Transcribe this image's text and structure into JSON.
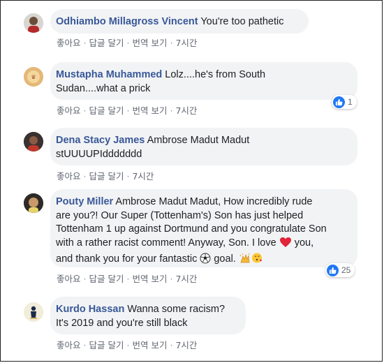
{
  "comments": [
    {
      "author": "Odhiambo Millagross Vincent",
      "text": " You're too pathetic",
      "actions": {
        "like": "좋아요",
        "reply": "답글 달기",
        "translate": "번역 보기",
        "time": "7시간"
      }
    },
    {
      "author": "Mustapha Muhammed",
      "line1": " Lolz....he's from South",
      "line2": "Sudan....what a prick",
      "reactions": "1",
      "actions": {
        "like": "좋아요",
        "reply": "답글 달기",
        "translate": "번역 보기",
        "time": "7시간"
      }
    },
    {
      "author": "Dena Stacy James",
      "line1": " Ambrose Madut Madut",
      "line2": "stUUUUPIddddddd",
      "actions": {
        "like": "좋아요",
        "reply": "답글 달기",
        "time": "7시간"
      }
    },
    {
      "author": "Pouty Miller",
      "line1": " Ambrose Madut Madut, How incredibly rude",
      "line2": "are you?! Our Super (Tottenham's) Son has just helped",
      "line3": "Tottenham 1 up against Dortmund and you congratulate Son",
      "line4a": "with a rather racist comment! Anyway, Son. I love ",
      "line4b": " you,",
      "line5a": "and thank you for your fantastic ",
      "line5b": " goal. ",
      "reactions": "25",
      "actions": {
        "like": "좋아요",
        "reply": "답글 달기",
        "translate": "번역 보기",
        "time": "7시간"
      }
    },
    {
      "author": "Kurdo Hassan",
      "line1": " Wanna some racism?",
      "line2": "It's 2019 and you're still black",
      "actions": {
        "like": "좋아요",
        "reply": "답글 달기",
        "translate": "번역 보기",
        "time": "7시간"
      }
    }
  ],
  "icons": {
    "like": "like-thumb-icon",
    "heart": "heart-emoji-icon",
    "soccer": "soccer-ball-emoji-icon",
    "clap": "clapping-hands-emoji-icon",
    "kiss": "face-blowing-kiss-emoji-icon"
  },
  "colors": {
    "author": "#385898",
    "bubble": "#f2f3f5",
    "like_blue": "#2078f4",
    "meta": "#616770"
  }
}
